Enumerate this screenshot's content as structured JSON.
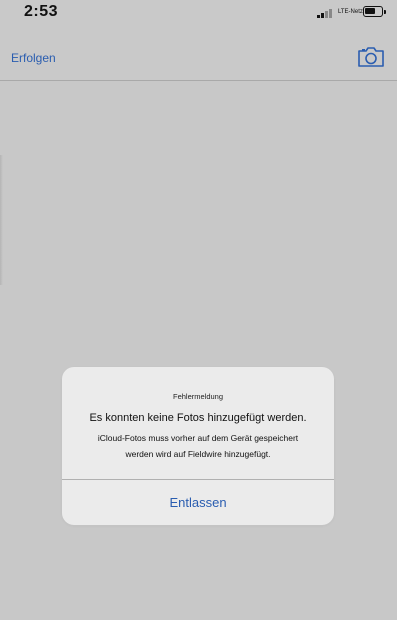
{
  "status_bar": {
    "time": "2:53",
    "carrier": "LTE-Netz",
    "battery_icon": "battery-icon",
    "signal_icon": "signal-bars-icon"
  },
  "nav": {
    "back_label": "Erfolgen",
    "camera_icon": "camera-icon"
  },
  "alert": {
    "title": "Fehlermeldung",
    "headline": "Es konnten keine Fotos hinzugefügt werden.",
    "body_line1": "iCloud-Fotos muss vorher auf dem Gerät gespeichert",
    "body_line2": "werden wird auf Fieldwire hinzugefügt.",
    "dismiss_label": "Entlassen"
  },
  "colors": {
    "accent": "#2a5db0",
    "overlay": "#c8c8c8",
    "alert_bg": "#ebebeb"
  }
}
